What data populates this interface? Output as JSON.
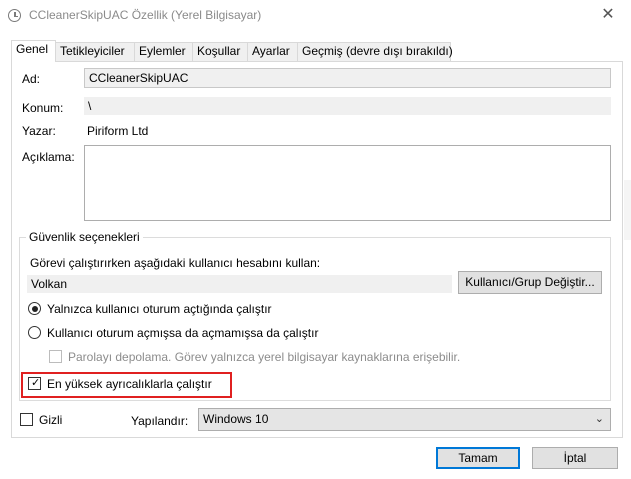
{
  "window": {
    "title": "CCleanerSkipUAC Özellik (Yerel Bilgisayar)",
    "close_glyph": "✕"
  },
  "tabs": [
    {
      "label": "Genel",
      "active": true
    },
    {
      "label": "Tetikleyiciler",
      "active": false
    },
    {
      "label": "Eylemler",
      "active": false
    },
    {
      "label": "Koşullar",
      "active": false
    },
    {
      "label": "Ayarlar",
      "active": false
    },
    {
      "label": "Geçmiş (devre dışı bırakıldı)",
      "active": false
    }
  ],
  "general": {
    "name_label": "Ad:",
    "name_value": "CCleanerSkipUAC",
    "location_label": "Konum:",
    "location_value": "\\",
    "author_label": "Yazar:",
    "author_value": "Piriform Ltd",
    "description_label": "Açıklama:",
    "description_value": ""
  },
  "security": {
    "group_title": "Güvenlik seçenekleri",
    "run_as_label": "Görevi çalıştırırken aşağıdaki kullanıcı hesabını kullan:",
    "user_value": "Volkan",
    "change_user_button": "Kullanıcı/Grup Değiştir...",
    "radio_logged_on": "Yalnızca kullanıcı oturum açtığında çalıştır",
    "radio_whether": "Kullanıcı oturum açmışsa da açmamışsa da çalıştır",
    "no_store_password": "Parolayı depolama. Görev yalnızca yerel bilgisayar kaynaklarına erişebilir.",
    "highest_privileges": "En yüksek ayrıcalıklarla çalıştır"
  },
  "bottom": {
    "hidden_label": "Gizli",
    "configure_label": "Yapılandır:",
    "configure_value": "Windows 10"
  },
  "buttons": {
    "ok": "Tamam",
    "cancel": "İptal"
  },
  "colors": {
    "highlight": "#e02020",
    "default_button_border": "#0078d7"
  }
}
